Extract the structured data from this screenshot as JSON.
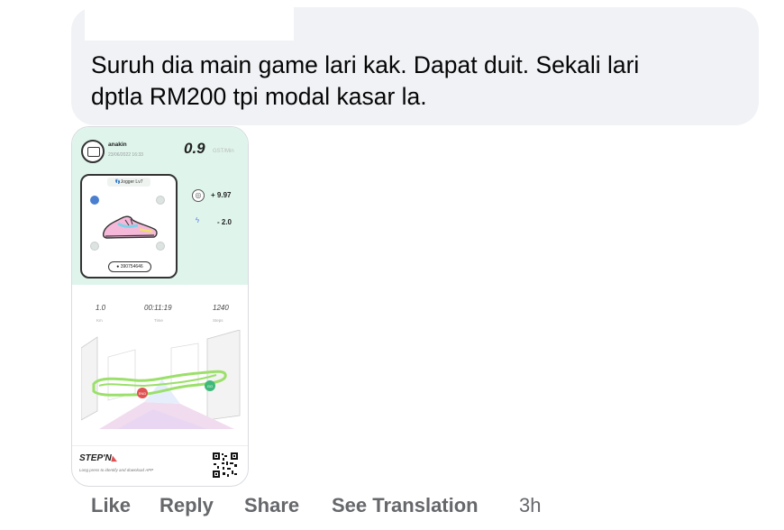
{
  "comment": {
    "text_line1": "Suruh dia main game lari kak. Dapat duit. Sekali lari",
    "text_line2": "dptla RM200 tpi modal kasar la."
  },
  "attachment": {
    "user_name": "anakin",
    "date": "23/06/2022 16:33",
    "rate_value": "0.9",
    "rate_unit": "GST/Min",
    "sneaker_class": "Jogger Lv7",
    "sneaker_id": "390754646",
    "gst_earned": "+ 9.97",
    "energy_used": "- 2.0",
    "distance_value": "1.0",
    "distance_label": "Km",
    "time_value": "00:11:19",
    "time_label": "Time",
    "steps_value": "1240",
    "steps_label": "Steps",
    "start_marker": "END",
    "end_marker": "GO",
    "brand": "STEP'N",
    "brand_sub": "Long press to identify and download APP",
    "colors": {
      "mint": "#dff5ec",
      "route": "#9be06a",
      "end_marker": "#e05252",
      "go_marker": "#3fb97a"
    }
  },
  "actions": {
    "like": "Like",
    "reply": "Reply",
    "share": "Share",
    "see_translation": "See Translation",
    "time": "3h"
  }
}
